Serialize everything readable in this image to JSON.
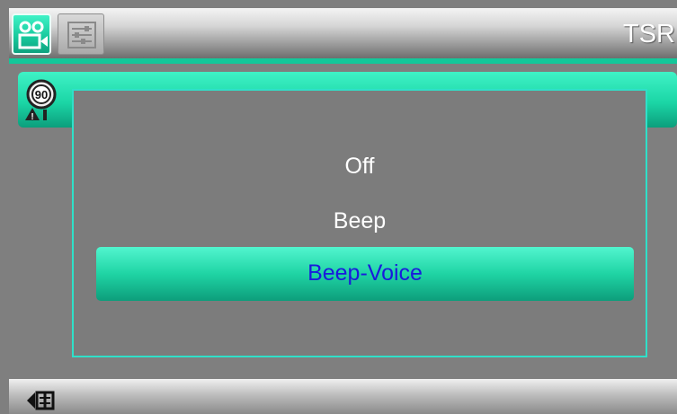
{
  "header": {
    "title": "TSR",
    "tabs": [
      {
        "name": "video",
        "icon": "video-camera-icon",
        "active": true
      },
      {
        "name": "settings",
        "icon": "settings-list-icon",
        "active": false
      }
    ]
  },
  "row": {
    "icon": "speed-limit-sign-icon",
    "sign_value": "90"
  },
  "popup": {
    "options": [
      "Off",
      "Beep",
      "Beep-Voice"
    ],
    "selected": "Beep-Voice"
  },
  "footer": {
    "back_icon": "back-icon"
  },
  "colors": {
    "accent": "#14c79a",
    "selected_text": "#1a1adc",
    "popup_border": "#2fe0c9"
  }
}
